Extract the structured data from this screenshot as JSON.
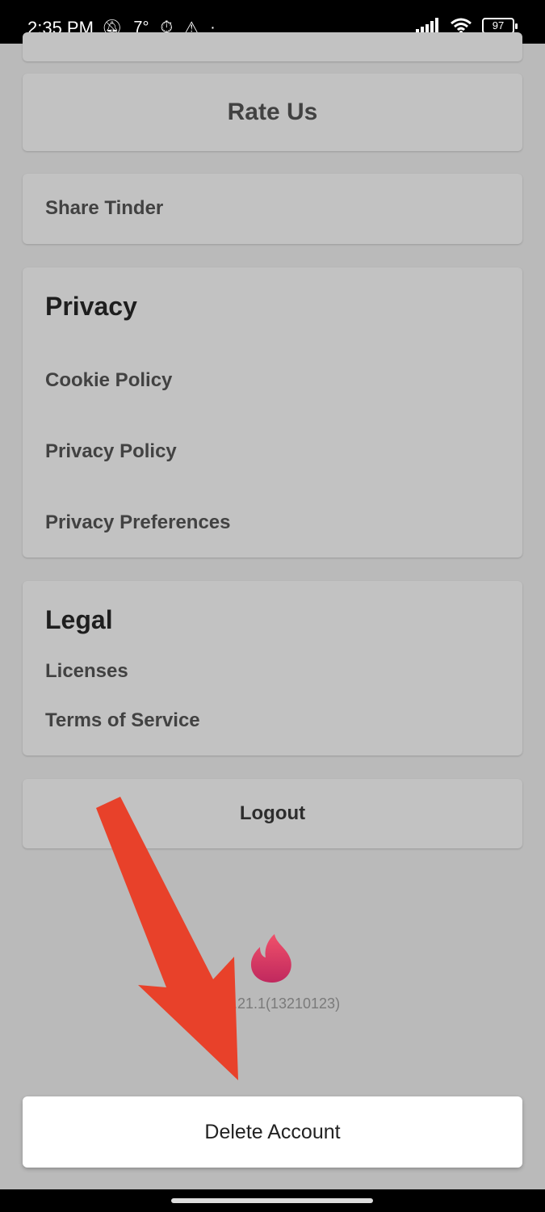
{
  "status_bar": {
    "time": "2:35 PM",
    "temperature": "7°",
    "battery": "97",
    "icons": [
      "mute-icon",
      "timer-icon",
      "warning-icon",
      "dot-icon",
      "signal-icon",
      "wifi-icon",
      "battery-icon"
    ]
  },
  "rate_us": {
    "label": "Rate Us"
  },
  "share": {
    "label": "Share Tinder"
  },
  "privacy": {
    "title": "Privacy",
    "items": [
      "Cookie Policy",
      "Privacy Policy",
      "Privacy Preferences"
    ]
  },
  "legal": {
    "title": "Legal",
    "items": [
      "Licenses",
      "Terms of Service"
    ]
  },
  "logout": {
    "label": "Logout"
  },
  "footer": {
    "version": "n 13.21.1(13210123)"
  },
  "delete_account": {
    "label": "Delete Account"
  },
  "colors": {
    "arrow": "#e8412a",
    "flame_top": "#f0516a",
    "flame_bottom": "#c0285e",
    "background": "#bababa",
    "card": "#c2c2c2"
  }
}
